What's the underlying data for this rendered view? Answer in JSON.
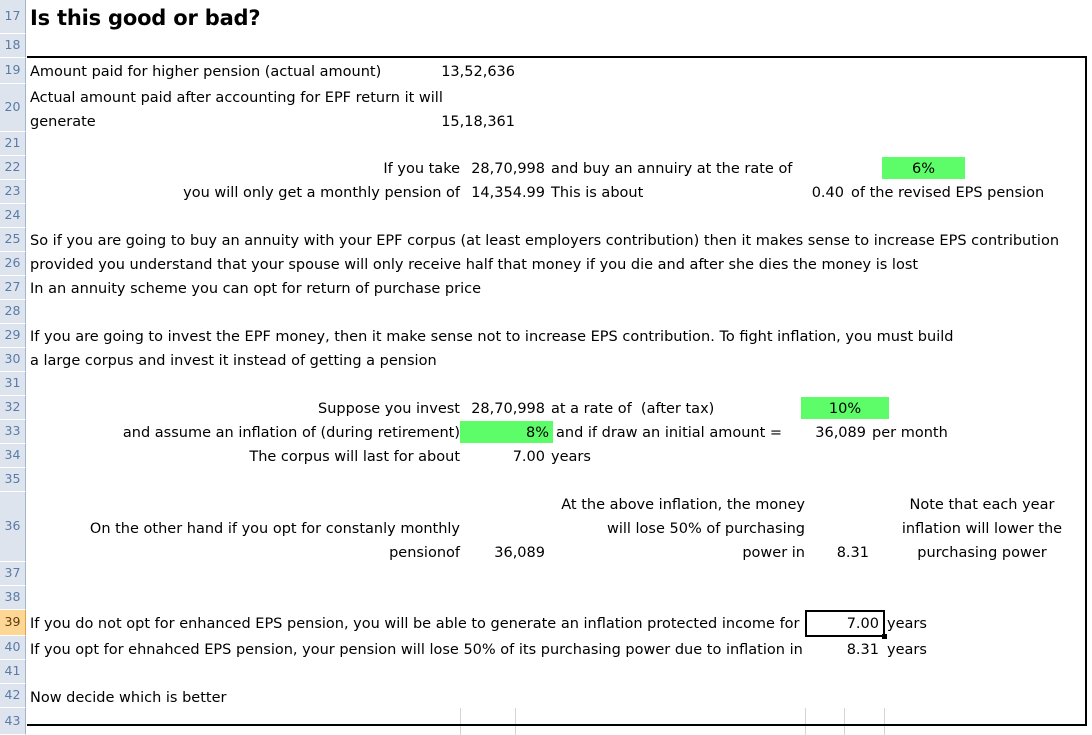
{
  "sheet": {
    "row_headers": [
      "17",
      "18",
      "19",
      "20",
      "21",
      "22",
      "23",
      "24",
      "25",
      "26",
      "27",
      "28",
      "29",
      "30",
      "31",
      "32",
      "33",
      "34",
      "35",
      "36",
      "37",
      "38",
      "39",
      "40",
      "41",
      "42",
      "43"
    ],
    "active_row": "39",
    "colors": {
      "highlight_green": "#5dfc69",
      "row_header_bg": "#dde4ee",
      "row_header_text": "#5a7ba6",
      "active_row_header_bg": "#ffd794",
      "grid_line": "#d4d4d4",
      "border_black": "#000000"
    }
  },
  "title": "Is this good or bad?",
  "rows": {
    "r19": {
      "label": "Amount paid for higher pension (actual amount)",
      "value": "13,52,636"
    },
    "r20": {
      "label_line1": "Actual amount paid after accounting for EPF return it will",
      "label_line2": "generate",
      "value": "15,18,361"
    },
    "r22": {
      "label": "If you take",
      "value": "28,70,998",
      "mid": "and buy an annuiry at the rate of",
      "rate": "6%"
    },
    "r23": {
      "label": "you will only get a monthly pension of",
      "value": "14,354.99",
      "mid": "This is about",
      "ratio": "0.40",
      "tail": "of the revised EPS pension"
    },
    "r25": "So if you are going to buy an annuity with your EPF corpus (at least employers contribution) then it makes sense to increase EPS contribution",
    "r26": "provided you understand that your spouse will only receive half that money if you die and after she dies the money is lost",
    "r27": "In an annuity scheme you can opt for return of purchase price",
    "r29": "If you are going to invest the EPF money, then it make sense not to increase EPS contribution. To fight inflation, you must build",
    "r30": "a large corpus and invest it instead of getting a pension",
    "r32": {
      "label": "Suppose you invest",
      "value": "28,70,998",
      "mid": "at a rate of  (after tax)",
      "rate": "10%"
    },
    "r33": {
      "label": "and assume an inflation of (during retirement)",
      "inflation": "8%",
      "mid": "and if draw an initial amount =",
      "amount": "36,089",
      "tail": "per month"
    },
    "r34": {
      "label": "The corpus will last for about",
      "value": "7.00",
      "tail": "years"
    },
    "r36": {
      "left_line1": "On the other hand if you opt for constanly monthly",
      "left_line2": "pensionof",
      "left_value": "36,089",
      "mid_line1": "At the above inflation, the money",
      "mid_line2": "will lose 50% of purchasing",
      "mid_line3": "power in",
      "mid_value": "8.31",
      "right_line1": "Note that each year",
      "right_line2": "inflation will lower the",
      "right_line3": "purchasing power"
    },
    "r39": {
      "label": "If you do not opt for enhanced EPS pension, you will be able to generate an inflation protected income for",
      "value": "7.00",
      "tail": "years"
    },
    "r40": {
      "label": "If you opt for ehnahced EPS pension, your pension will lose 50% of its purchasing power due to inflation in",
      "value": "8.31",
      "tail": "years"
    },
    "r42": "Now decide which is better"
  }
}
